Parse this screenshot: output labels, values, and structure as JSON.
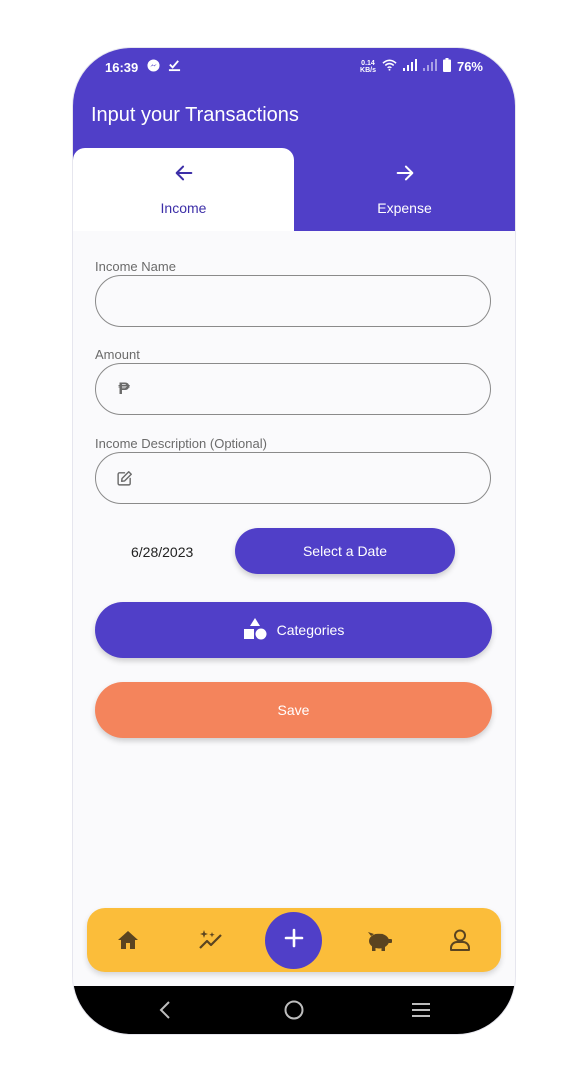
{
  "status_bar": {
    "time": "16:39",
    "net_speed_value": "0.14",
    "net_speed_unit": "KB/s",
    "battery": "76%"
  },
  "header": {
    "title": "Input your Transactions"
  },
  "tabs": [
    {
      "label": "Income",
      "icon": "arrow-left-icon",
      "selected": true
    },
    {
      "label": "Expense",
      "icon": "arrow-right-icon",
      "selected": false
    }
  ],
  "form": {
    "income_name": {
      "label": "Income Name",
      "value": ""
    },
    "amount": {
      "label": "Amount",
      "prefix": "₱",
      "value": ""
    },
    "description": {
      "label": "Income Description (Optional)",
      "icon": "edit-icon",
      "value": ""
    },
    "date_value": "6/28/2023",
    "select_date_label": "Select a Date",
    "categories_label": "Categories",
    "save_label": "Save"
  },
  "bottom_nav": {
    "items": [
      "home-icon",
      "sparkle-chart-icon",
      "add-icon",
      "piggy-bank-icon",
      "user-icon"
    ]
  },
  "colors": {
    "primary": "#503fc8",
    "accent_orange": "#f4845c",
    "nav_yellow": "#fbbd3a",
    "background": "#fafafc"
  }
}
